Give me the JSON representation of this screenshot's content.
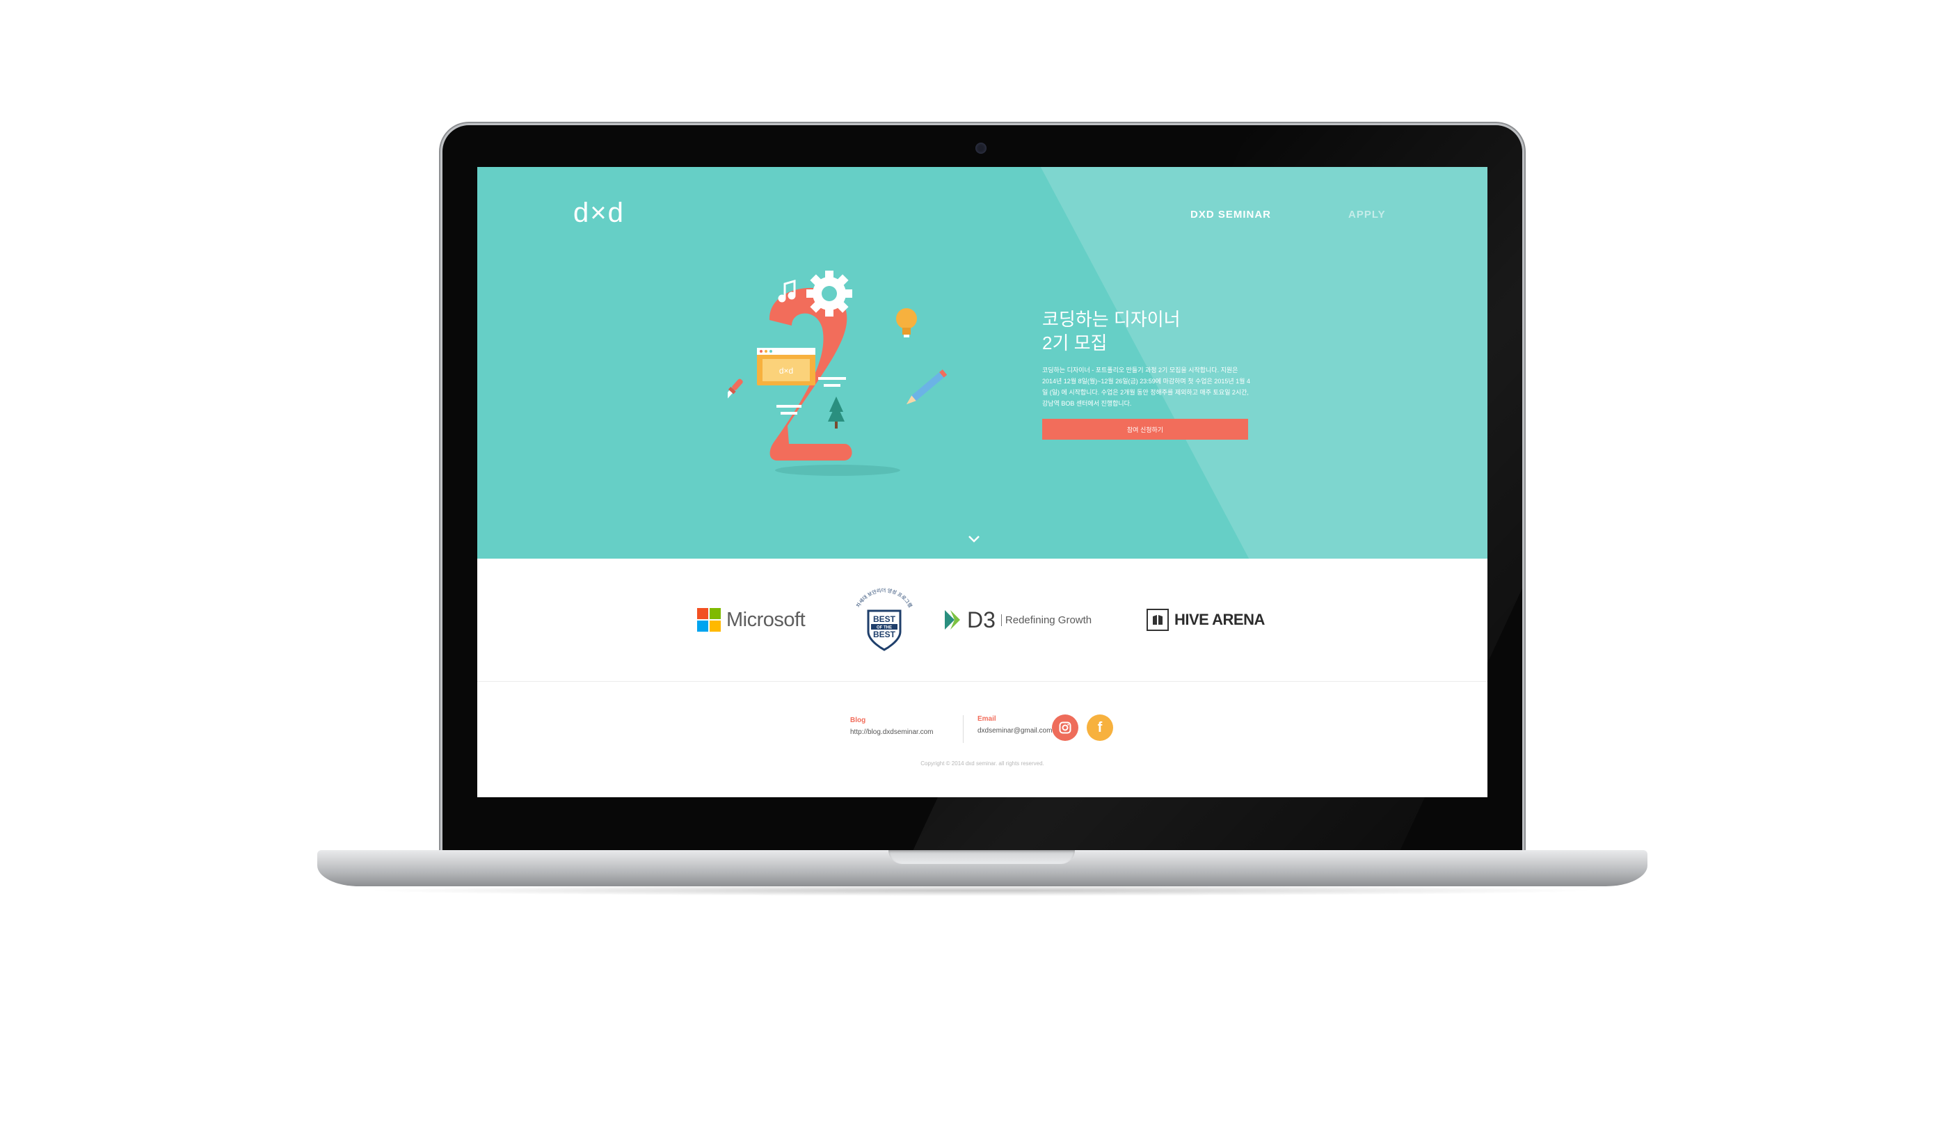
{
  "site": {
    "logo": "d×d",
    "nav": [
      {
        "label": "DXD SEMINAR"
      },
      {
        "label": "APPLY"
      }
    ]
  },
  "hero": {
    "title_line1": "코딩하는 디자이너",
    "title_line2": "2기 모집",
    "description": "코딩하는 디자이너 - 포트폴리오 만들기 과정 2기 모집을 시작합니다. 지원은 2014년 12월 8일(월)~12월 26일(금) 23:59에 마감하며 첫 수업은 2015년 1월 4일 (일) 에 시작합니다. 수업은 2개월 동안 정해주를 제외하고 매주 토요일 2시간, 강남역 BOB 센터에서 진행합니다.",
    "apply_button": "참여 신청하기",
    "illustration_window_label": "d×d"
  },
  "partners": {
    "microsoft": "Microsoft",
    "bob_badge": {
      "arc_text": "차세대 보안리더 양성 프로그램",
      "line1": "BEST",
      "line2": "OF THE",
      "line3": "BEST"
    },
    "d3": {
      "name": "D3",
      "tagline": "Redefining Growth"
    },
    "hive": "HIVE ARENA"
  },
  "footer": {
    "blog_label": "Blog",
    "blog_url": "http://blog.dxdseminar.com",
    "email_label": "Email",
    "email": "dxdseminar@gmail.com",
    "instagram_icon": "instagram-icon",
    "facebook_icon": "facebook-icon",
    "facebook_glyph": "f",
    "copyright": "Copyright © 2014 dxd seminar. all rights reserved."
  },
  "colors": {
    "hero_bg": "#66cfc6",
    "accent": "#f26d5b",
    "facebook": "#f7b13e"
  }
}
